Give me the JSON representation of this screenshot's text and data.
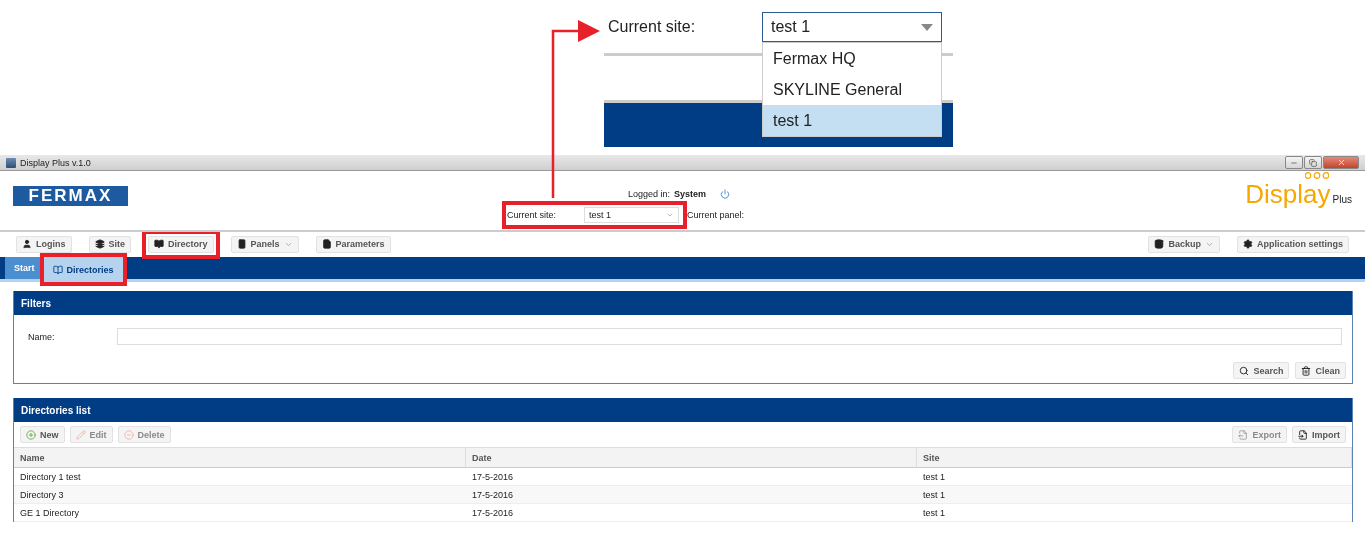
{
  "zoom_inset": {
    "label": "Current site:",
    "value": "test 1",
    "options": [
      {
        "label": "Fermax HQ",
        "selected": false
      },
      {
        "label": "SKYLINE General",
        "selected": false
      },
      {
        "label": "test 1",
        "selected": true
      }
    ]
  },
  "window": {
    "title": "Display Plus v.1.0"
  },
  "header": {
    "logo": "FERMAX",
    "logged_in_label": "Logged in:",
    "user": "System",
    "site_label": "Current site:",
    "site_value": "test 1",
    "site_highlighted": true,
    "panel_label": "Current panel:",
    "brand": "Display",
    "brand_sub": "Plus"
  },
  "toolbar": {
    "left": [
      {
        "label": "Logins",
        "dropdown": false,
        "highlighted": false
      },
      {
        "label": "Site",
        "dropdown": false,
        "highlighted": false
      },
      {
        "label": "Directory",
        "dropdown": false,
        "highlighted": true
      },
      {
        "label": "Panels",
        "dropdown": true,
        "highlighted": false
      },
      {
        "label": "Parameters",
        "dropdown": false,
        "highlighted": false
      }
    ],
    "right": [
      {
        "label": "Backup",
        "dropdown": true,
        "highlighted": false
      },
      {
        "label": "Application settings",
        "dropdown": false,
        "highlighted": false
      }
    ]
  },
  "tabs": [
    {
      "label": "Start",
      "selected": false,
      "highlighted": false
    },
    {
      "label": "Directories",
      "selected": true,
      "highlighted": true
    }
  ],
  "filters": {
    "title": "Filters",
    "field_label": "Name:",
    "buttons": [
      "Search",
      "Clean"
    ]
  },
  "list": {
    "title": "Directories list",
    "actions": [
      {
        "label": "New",
        "disabled": false
      },
      {
        "label": "Edit",
        "disabled": true
      },
      {
        "label": "Delete",
        "disabled": true
      }
    ],
    "io": [
      {
        "label": "Export",
        "disabled": true
      },
      {
        "label": "Import",
        "disabled": false
      }
    ],
    "columns": [
      "Name",
      "Date",
      "Site"
    ],
    "rows": [
      [
        "Directory 1 test",
        "17-5-2016",
        "test 1"
      ],
      [
        "Directory 3",
        "17-5-2016",
        "test 1"
      ],
      [
        "GE 1 Directory",
        "17-5-2016",
        "test 1"
      ]
    ]
  }
}
